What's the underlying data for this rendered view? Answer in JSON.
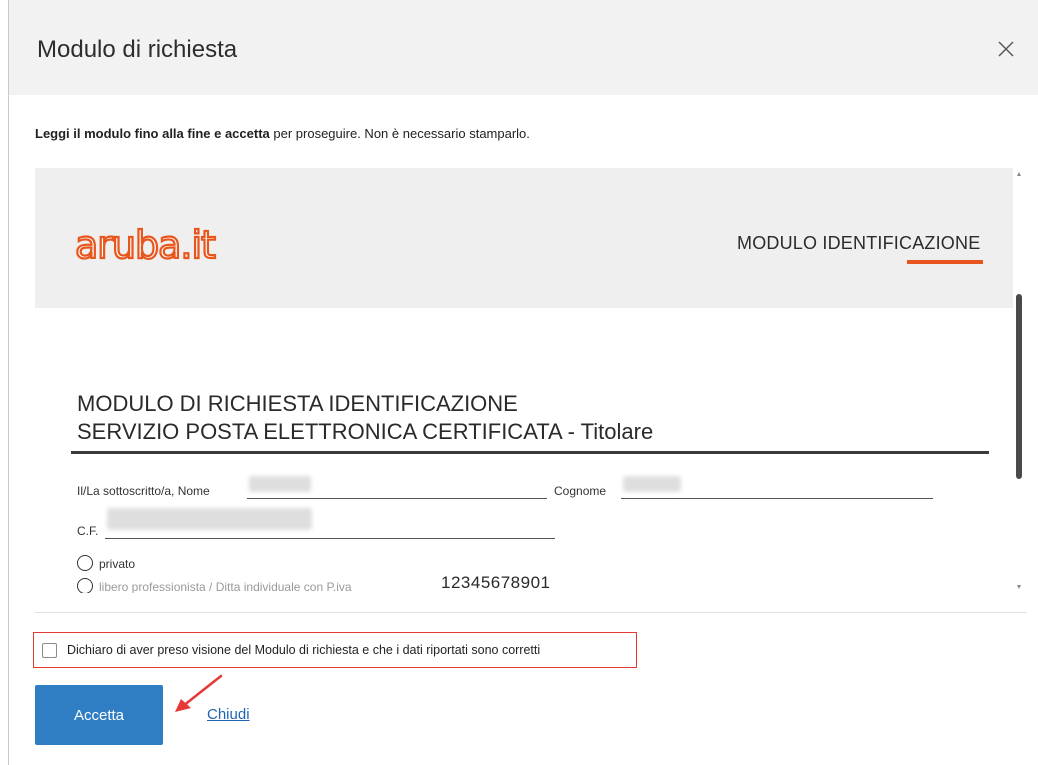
{
  "dialog": {
    "title": "Modulo di richiesta",
    "close_label": "×"
  },
  "intro": {
    "bold": "Leggi il modulo fino alla fine e accetta",
    "rest": " per proseguire. Non è necessario stamparlo."
  },
  "document": {
    "logo_text": "aruba.it",
    "header_label": "MODULO IDENTIFICAZIONE",
    "title_line1": "MODULO DI RICHIESTA IDENTIFICAZIONE",
    "title_line2": "SERVIZIO POSTA ELETTRONICA CERTIFICATA - Titolare",
    "name_label": "Il/La sottoscritto/a, Nome",
    "surname_label": "Cognome",
    "cf_label": "C.F.",
    "option_private": "privato",
    "option_professional": "libero professionista / Ditta individuale con P.iva",
    "piva_value": "12345678901"
  },
  "consent": {
    "text": "Dichiaro di aver preso visione del Modulo di richiesta e che i dati riportati sono corretti",
    "checked": false
  },
  "actions": {
    "accept_label": "Accetta",
    "close_link": "Chiudi"
  },
  "colors": {
    "accent": "#2f7dc3",
    "brand_orange": "#e8561d",
    "highlight_red": "#e53935"
  }
}
